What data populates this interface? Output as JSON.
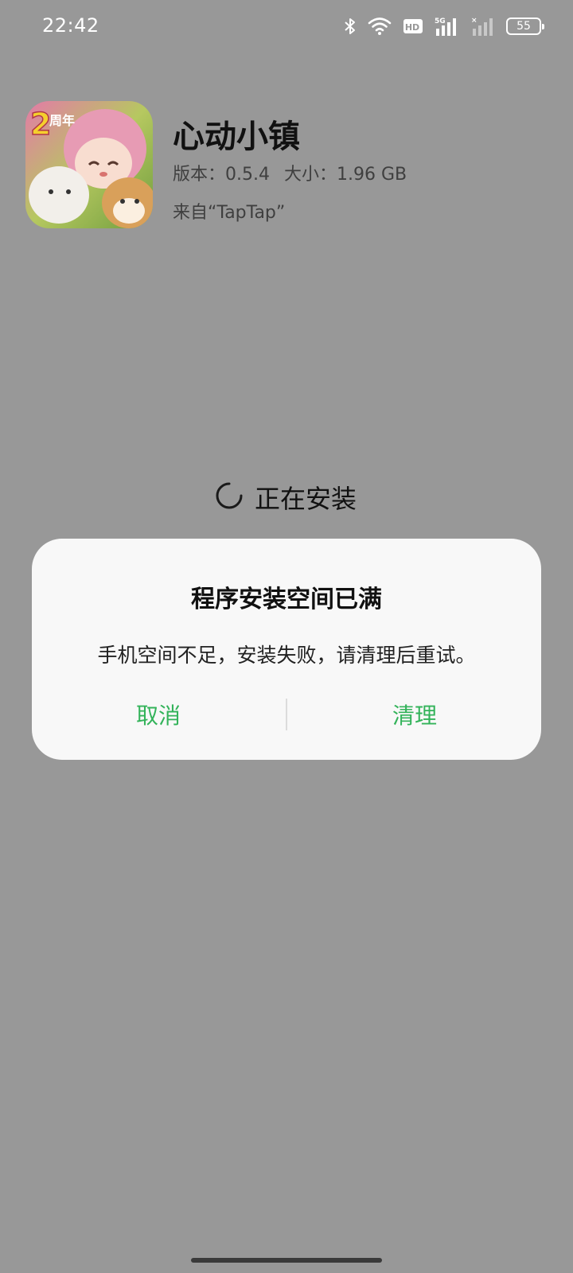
{
  "status_bar": {
    "time": "22:42",
    "battery": "55",
    "icons": [
      "bluetooth-icon",
      "wifi-icon",
      "hd-icon",
      "signal-5g-icon",
      "signal-no-sim-icon",
      "battery-icon"
    ]
  },
  "app": {
    "name": "心动小镇",
    "version_label": "版本：0.5.4",
    "size_label": "大小：1.96 GB",
    "source": "来自“TapTap”",
    "icon_badge": "2周年"
  },
  "install": {
    "status_text": "正在安装"
  },
  "dialog": {
    "title": "程序安装空间已满",
    "message": "手机空间不足，安装失败，请清理后重试。",
    "cancel_label": "取消",
    "clean_label": "清理"
  },
  "colors": {
    "overlay_bg": "#989898",
    "dialog_bg": "#f8f8f8",
    "accent_green": "#33b35a"
  }
}
